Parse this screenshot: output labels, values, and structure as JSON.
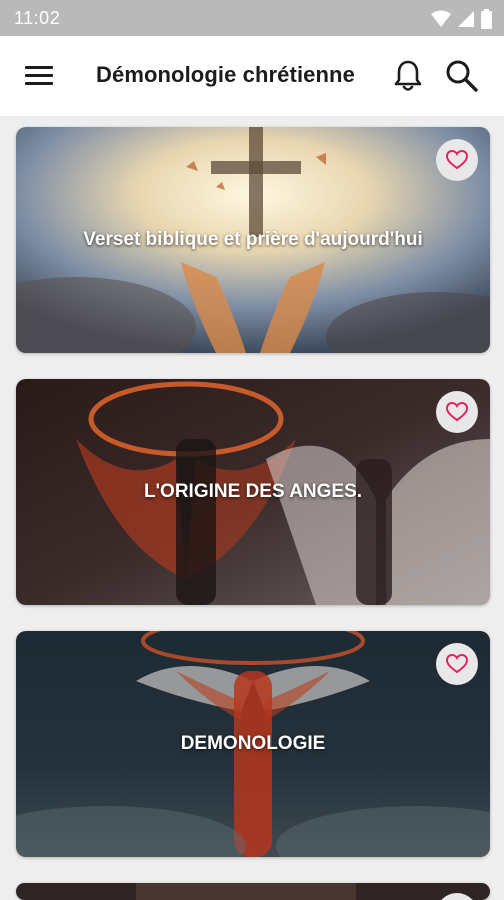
{
  "status_bar": {
    "time": "11:02"
  },
  "app_bar": {
    "title": "Démonologie chrétienne"
  },
  "cards": [
    {
      "title": "Verset biblique et prière d'aujourd'hui"
    },
    {
      "title": "L'ORIGINE DES ANGES."
    },
    {
      "title": "DEMONOLOGIE"
    }
  ],
  "colors": {
    "favorite_heart": "#e0245e",
    "status_bar_bg": "#b9b9b9",
    "app_bar_bg": "#ffffff"
  }
}
